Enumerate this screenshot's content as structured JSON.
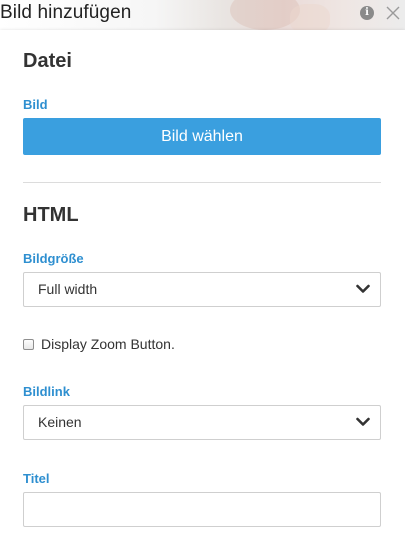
{
  "dialog": {
    "title": "Bild hinzufügen",
    "info_icon": "info-icon",
    "close_icon": "close-icon"
  },
  "datei": {
    "heading": "Datei",
    "image_label": "Bild",
    "choose_button": "Bild wählen"
  },
  "html": {
    "heading": "HTML",
    "size_label": "Bildgröße",
    "size_value": "Full width",
    "zoom_checkbox_label": "Display Zoom Button.",
    "zoom_checked": false,
    "link_label": "Bildlink",
    "link_value": "Keinen",
    "title_label": "Titel",
    "title_value": ""
  },
  "colors": {
    "accent": "#3a9fdf",
    "label": "#2e8fd0"
  }
}
